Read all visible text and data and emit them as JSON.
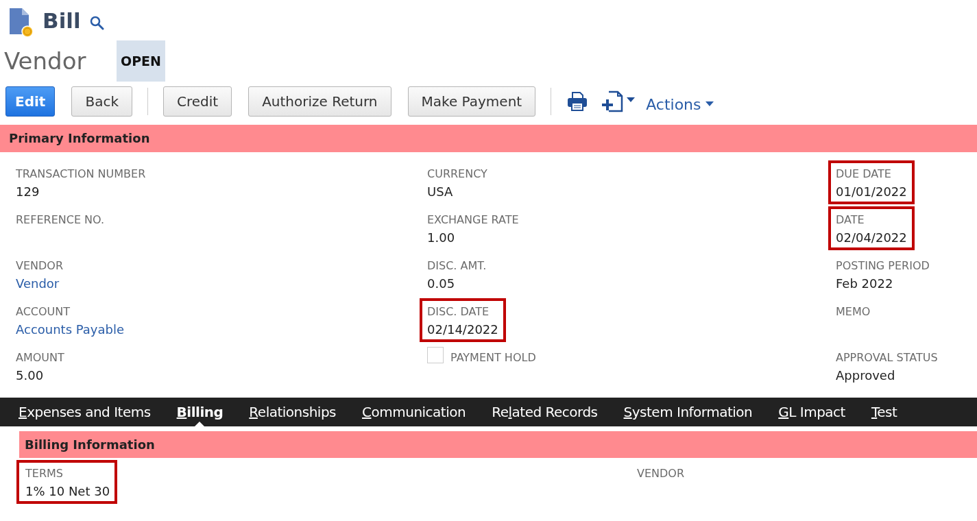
{
  "record": {
    "type": "Bill",
    "name": "Vendor",
    "status": "OPEN"
  },
  "toolbar": {
    "buttons": [
      {
        "label": "Edit",
        "primary": true
      },
      {
        "label": "Back",
        "primary": false
      },
      {
        "label": "Credit",
        "primary": false
      },
      {
        "label": "Authorize Return",
        "primary": false
      },
      {
        "label": "Make Payment",
        "primary": false
      }
    ],
    "actions": "Actions"
  },
  "primary_section": {
    "title": "Primary Information",
    "columns": [
      [
        {
          "kind": "text",
          "label": "TRANSACTION NUMBER",
          "value": "129",
          "highlighted": false
        },
        {
          "kind": "text",
          "label": "REFERENCE NO.",
          "highlighted": false
        },
        {
          "kind": "link",
          "label": "VENDOR",
          "value": "Vendor",
          "highlighted": false
        },
        {
          "kind": "link",
          "label": "ACCOUNT",
          "value": "Accounts Payable",
          "highlighted": false
        },
        {
          "kind": "text",
          "label": "AMOUNT",
          "value": "5.00",
          "highlighted": false
        }
      ],
      [
        {
          "kind": "text",
          "label": "CURRENCY",
          "value": "USA",
          "highlighted": false
        },
        {
          "kind": "text",
          "label": "EXCHANGE RATE",
          "value": "1.00",
          "highlighted": false
        },
        {
          "kind": "text",
          "label": "DISC. AMT.",
          "value": "0.05",
          "highlighted": false
        },
        {
          "kind": "text",
          "label": "DISC. DATE",
          "value": "02/14/2022",
          "highlighted": true
        },
        {
          "kind": "checkbox",
          "label": "PAYMENT HOLD",
          "checked": false,
          "highlighted": false
        }
      ],
      [
        {
          "kind": "text",
          "label": "DUE DATE",
          "value": "01/01/2022",
          "highlighted": true
        },
        {
          "kind": "text",
          "label": "DATE",
          "value": "02/04/2022",
          "highlighted": true
        },
        {
          "kind": "text",
          "label": "POSTING PERIOD",
          "value": "Feb 2022",
          "highlighted": false
        },
        {
          "kind": "text",
          "label": "MEMO",
          "highlighted": false
        },
        {
          "kind": "text",
          "label": "APPROVAL STATUS",
          "value": "Approved",
          "highlighted": false
        }
      ]
    ]
  },
  "tabs": [
    {
      "key": "E",
      "after": "xpenses and Items",
      "selected": false
    },
    {
      "key": "B",
      "after": "illing",
      "selected": true
    },
    {
      "key": "R",
      "after": "elationships",
      "selected": false
    },
    {
      "key": "C",
      "after": "ommunication",
      "selected": false
    },
    {
      "before": "Re",
      "key": "l",
      "after": "ated Records",
      "selected": false
    },
    {
      "key": "S",
      "after": "ystem Information",
      "selected": false
    },
    {
      "key": "G",
      "after": "L Impact",
      "selected": false
    },
    {
      "key": "T",
      "after": "est",
      "selected": false
    }
  ],
  "billing_section": {
    "title": "Billing Information",
    "fields": [
      {
        "kind": "text",
        "label": "TERMS",
        "value": "1% 10 Net 30",
        "highlighted": true
      },
      {
        "kind": "text",
        "label": "VENDOR",
        "highlighted": false
      }
    ]
  }
}
